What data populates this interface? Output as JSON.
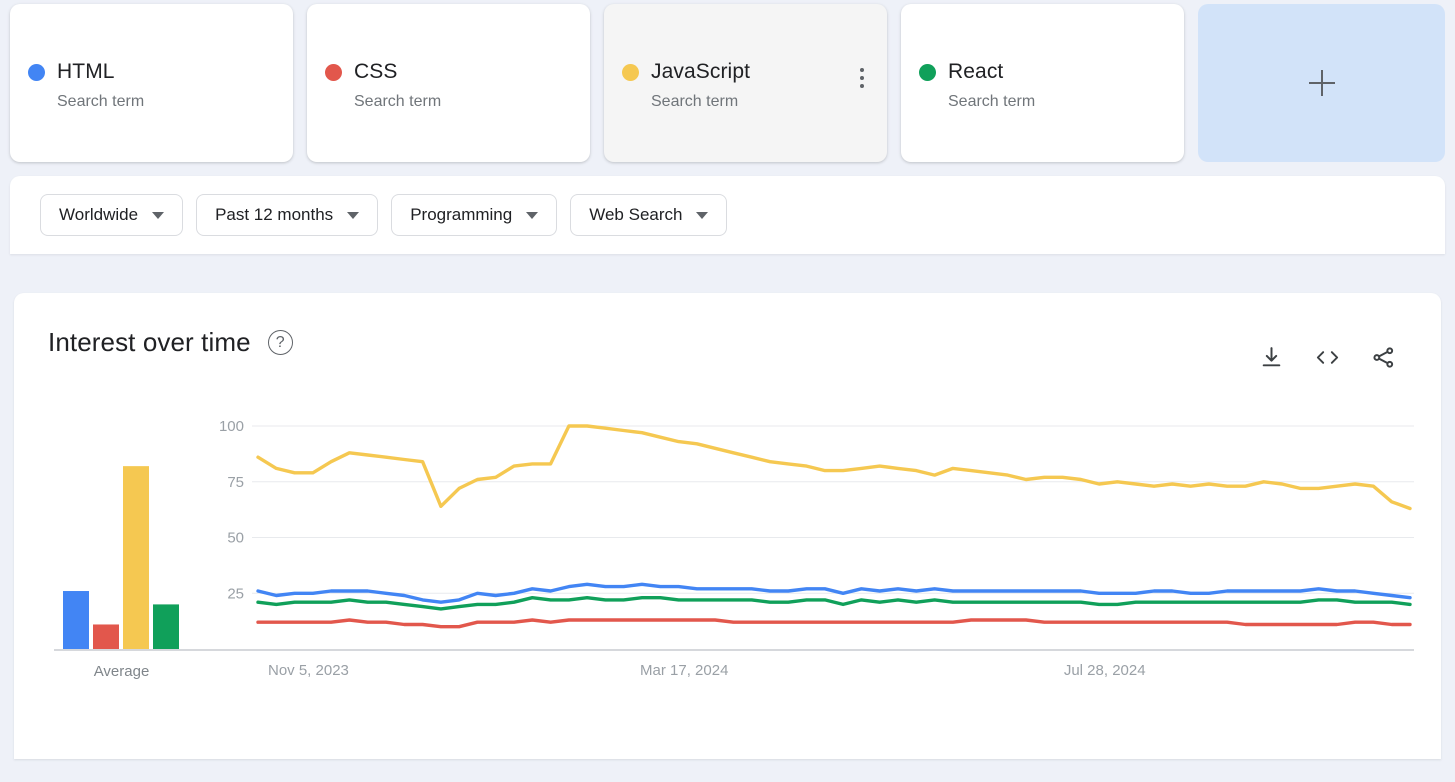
{
  "terms": [
    {
      "label": "HTML",
      "sublabel": "Search term",
      "color": "#4285f4",
      "hovered": false
    },
    {
      "label": "CSS",
      "sublabel": "Search term",
      "color": "#e2574c",
      "hovered": false
    },
    {
      "label": "JavaScript",
      "sublabel": "Search term",
      "color": "#f5c851",
      "hovered": true
    },
    {
      "label": "React",
      "sublabel": "Search term",
      "color": "#10a05a",
      "hovered": false
    }
  ],
  "add_card": {
    "icon": "plus-icon"
  },
  "filters": [
    {
      "label": "Worldwide",
      "icon": "chevron-down-icon"
    },
    {
      "label": "Past 12 months",
      "icon": "chevron-down-icon"
    },
    {
      "label": "Programming",
      "icon": "chevron-down-icon"
    },
    {
      "label": "Web Search",
      "icon": "chevron-down-icon"
    }
  ],
  "chart_card": {
    "title": "Interest over time",
    "help_icon": "help-circle-icon",
    "help_glyph": "?",
    "actions": [
      {
        "name": "download-icon",
        "label": "Download"
      },
      {
        "name": "embed-icon",
        "label": "Embed"
      },
      {
        "name": "share-icon",
        "label": "Share"
      }
    ]
  },
  "chart_data": {
    "type": "line",
    "title": "Interest over time",
    "xlabel": "",
    "ylabel": "",
    "ylim": [
      0,
      100
    ],
    "yticks": [
      25,
      50,
      75,
      100
    ],
    "xtick_labels": [
      "Nov 5, 2023",
      "Mar 17, 2024",
      "Jul 28, 2024"
    ],
    "grid": true,
    "legend_position": "top-cards",
    "average_panel": {
      "label": "Average",
      "type": "bar",
      "categories": [
        "HTML",
        "CSS",
        "JavaScript",
        "React"
      ],
      "values": [
        26,
        11,
        82,
        20
      ],
      "colors": [
        "#4285f4",
        "#e2574c",
        "#f5c851",
        "#10a05a"
      ]
    },
    "series": [
      {
        "name": "HTML",
        "color": "#4285f4",
        "values": [
          26,
          24,
          25,
          25,
          26,
          26,
          26,
          25,
          24,
          22,
          21,
          22,
          25,
          24,
          25,
          27,
          26,
          28,
          29,
          28,
          28,
          29,
          28,
          28,
          27,
          27,
          27,
          27,
          26,
          26,
          27,
          27,
          25,
          27,
          26,
          27,
          26,
          27,
          26,
          26,
          26,
          26,
          26,
          26,
          26,
          26,
          25,
          25,
          25,
          26,
          26,
          25,
          25,
          26,
          26,
          26,
          26,
          26,
          27,
          26,
          26,
          25,
          24,
          23
        ]
      },
      {
        "name": "CSS",
        "color": "#e2574c",
        "values": [
          12,
          12,
          12,
          12,
          12,
          13,
          12,
          12,
          11,
          11,
          10,
          10,
          12,
          12,
          12,
          13,
          12,
          13,
          13,
          13,
          13,
          13,
          13,
          13,
          13,
          13,
          12,
          12,
          12,
          12,
          12,
          12,
          12,
          12,
          12,
          12,
          12,
          12,
          12,
          13,
          13,
          13,
          13,
          12,
          12,
          12,
          12,
          12,
          12,
          12,
          12,
          12,
          12,
          12,
          11,
          11,
          11,
          11,
          11,
          11,
          12,
          12,
          11,
          11
        ]
      },
      {
        "name": "JavaScript",
        "color": "#f5c851",
        "values": [
          86,
          81,
          79,
          79,
          84,
          88,
          87,
          86,
          85,
          84,
          64,
          72,
          76,
          77,
          82,
          83,
          83,
          100,
          100,
          99,
          98,
          97,
          95,
          93,
          92,
          90,
          88,
          86,
          84,
          83,
          82,
          80,
          80,
          81,
          82,
          81,
          80,
          78,
          81,
          80,
          79,
          78,
          76,
          77,
          77,
          76,
          74,
          75,
          74,
          73,
          74,
          73,
          74,
          73,
          73,
          75,
          74,
          72,
          72,
          73,
          74,
          73,
          66,
          63
        ]
      },
      {
        "name": "React",
        "color": "#10a05a",
        "values": [
          21,
          20,
          21,
          21,
          21,
          22,
          21,
          21,
          20,
          19,
          18,
          19,
          20,
          20,
          21,
          23,
          22,
          22,
          23,
          22,
          22,
          23,
          23,
          22,
          22,
          22,
          22,
          22,
          21,
          21,
          22,
          22,
          20,
          22,
          21,
          22,
          21,
          22,
          21,
          21,
          21,
          21,
          21,
          21,
          21,
          21,
          20,
          20,
          21,
          21,
          21,
          21,
          21,
          21,
          21,
          21,
          21,
          21,
          22,
          22,
          21,
          21,
          21,
          20
        ]
      }
    ]
  }
}
